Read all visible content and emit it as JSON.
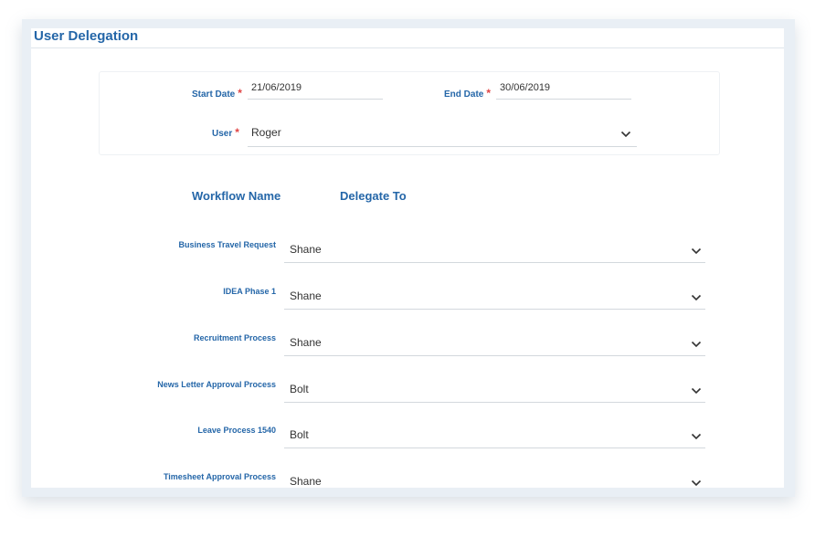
{
  "panel": {
    "title": "User Delegation"
  },
  "filters": {
    "start_date": {
      "label": "Start Date",
      "required": "*",
      "value": "21/06/2019"
    },
    "end_date": {
      "label": "End Date",
      "required": "*",
      "value": "30/06/2019"
    },
    "user": {
      "label": "User",
      "required": "*",
      "value": "Roger"
    }
  },
  "table": {
    "headers": {
      "workflow": "Workflow Name",
      "delegate": "Delegate To"
    },
    "rows": [
      {
        "workflow": "Business Travel Request",
        "delegate": "Shane"
      },
      {
        "workflow": "IDEA Phase 1",
        "delegate": "Shane"
      },
      {
        "workflow": "Recruitment Process",
        "delegate": "Shane"
      },
      {
        "workflow": "News Letter Approval Process",
        "delegate": "Bolt"
      },
      {
        "workflow": "Leave Process 1540",
        "delegate": "Bolt"
      },
      {
        "workflow": "Timesheet Approval Process",
        "delegate": "Shane"
      }
    ]
  },
  "icons": {
    "dropdown": "chevron-down-icon"
  },
  "colors": {
    "accent": "#2466a8",
    "required": "#e04545",
    "underline": "#d3d8dd"
  }
}
